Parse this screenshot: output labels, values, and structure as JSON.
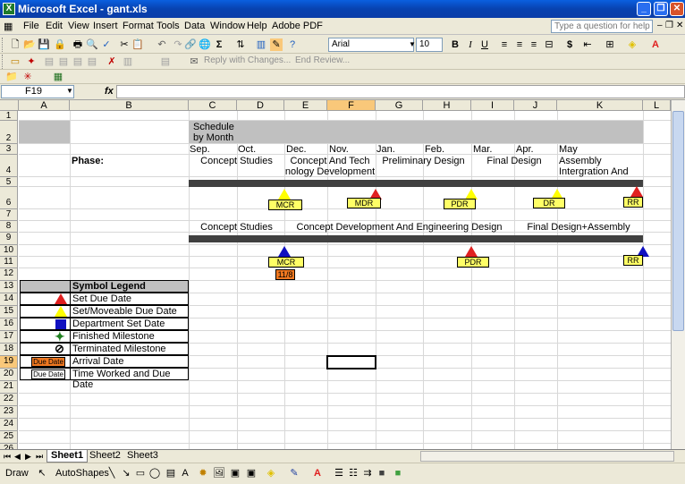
{
  "window": {
    "title": "Microsoft Excel - gant.xls"
  },
  "menu": {
    "items": [
      "File",
      "Edit",
      "View",
      "Insert",
      "Format",
      "Tools",
      "Data",
      "Window",
      "Help",
      "Adobe PDF"
    ],
    "help_placeholder": "Type a question for help"
  },
  "toolbar": {
    "font": "Arial",
    "size": "10",
    "review_text": "Reply with Changes...",
    "end_review": "End Review..."
  },
  "formula": {
    "cell_ref": "F19",
    "fx": "fx",
    "value": ""
  },
  "columns": [
    "A",
    "B",
    "C",
    "D",
    "E",
    "F",
    "G",
    "H",
    "I",
    "J",
    "K",
    "L"
  ],
  "selected_column": "F",
  "rows": [
    "1",
    "2",
    "3",
    "4",
    "5",
    "6",
    "7",
    "8",
    "9",
    "10",
    "11",
    "12",
    "13",
    "14",
    "15",
    "16",
    "17",
    "18",
    "19",
    "20",
    "21",
    "22",
    "23",
    "24",
    "25",
    "26"
  ],
  "selected_row": "19",
  "schedule": {
    "header_line1": "Schedule",
    "header_line2": "by Month",
    "months": [
      "Sep.",
      "Oct.",
      "Dec.",
      "Nov.",
      "Jan.",
      "Feb.",
      "Mar.",
      "Apr.",
      "May"
    ],
    "phase_label": "Phase:",
    "phases": [
      "Concept Studies",
      "Concept And Tech nology Development",
      "Preliminary Design",
      "Final Design",
      "Assembly Intergration And Test"
    ],
    "phases_row8": [
      "Concept Studies",
      "Concept Development And Engineering Design",
      "Final Design+Assembly"
    ],
    "milestones_row6": [
      "MCR",
      "MDR",
      "PDR",
      "DR",
      "RR"
    ],
    "milestones_row11": [
      "MCR",
      "PDR",
      "RR"
    ],
    "date_box": "11/8"
  },
  "legend": {
    "title": "Symbol Legend",
    "items": [
      "Set Due Date",
      "Set/Moveable Due Date",
      "Department Set Date",
      "Finished Milestone",
      "Terminated Milestone",
      "Arrival Date",
      "Time Worked and Due Date"
    ],
    "due_date_label": "Due Date"
  },
  "colors": {
    "red": "#e02020",
    "yellow": "#ffff00",
    "blue": "#1010c0",
    "orange": "#f07820"
  },
  "sheet_tabs": [
    "Sheet1",
    "Sheet2",
    "Sheet3"
  ],
  "active_tab": "Sheet1",
  "drawbar": {
    "draw": "Draw",
    "autoshapes": "AutoShapes"
  }
}
